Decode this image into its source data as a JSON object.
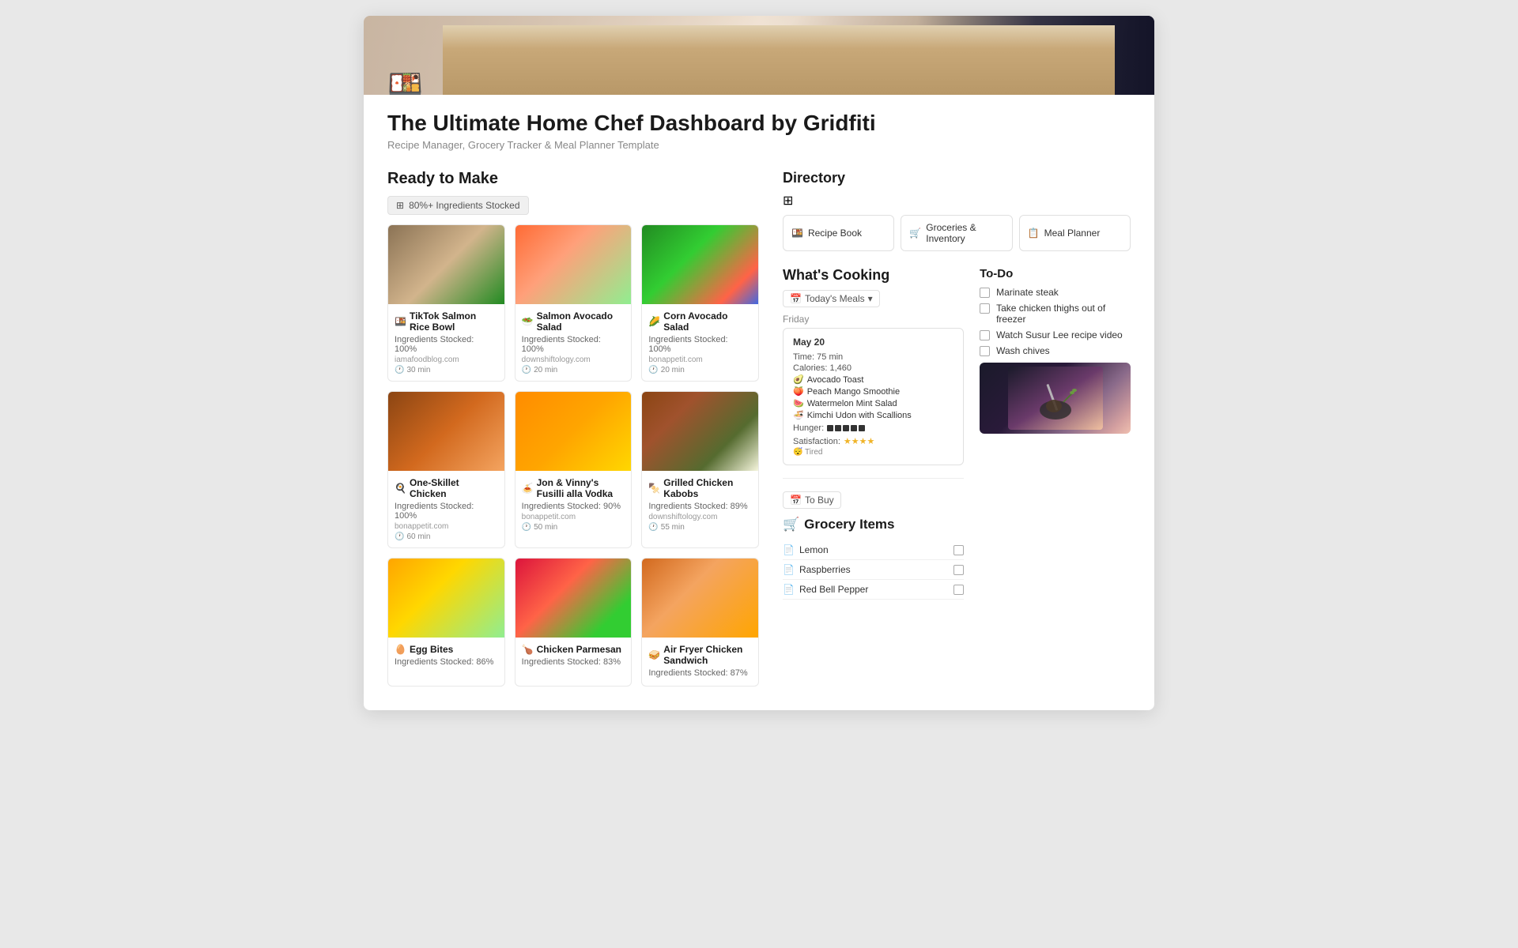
{
  "page": {
    "title": "The Ultimate Home Chef Dashboard by Gridfiti",
    "subtitle": "Recipe Manager, Grocery Tracker & Meal Planner Template",
    "emoji": "🍱"
  },
  "left": {
    "section_title": "Ready to Make",
    "filter_label": "80%+ Ingredients Stocked",
    "recipes": [
      {
        "name": "TikTok Salmon Rice Bowl",
        "emoji": "🍱",
        "stocked": "Ingredients Stocked: 100%",
        "source": "iamafoodblog.com",
        "time": "30 min",
        "color_class": "img-salmon-rice"
      },
      {
        "name": "Salmon Avocado Salad",
        "emoji": "🥗",
        "stocked": "Ingredients Stocked: 100%",
        "source": "downshiftology.com",
        "time": "20 min",
        "color_class": "img-salmon-avocado"
      },
      {
        "name": "Corn Avocado Salad",
        "emoji": "🌽",
        "stocked": "Ingredients Stocked: 100%",
        "source": "bonappetit.com",
        "time": "20 min",
        "color_class": "img-corn-avocado"
      },
      {
        "name": "One-Skillet Chicken",
        "emoji": "🍳",
        "stocked": "Ingredients Stocked: 100%",
        "source": "bonappetit.com",
        "time": "60 min",
        "color_class": "img-chicken-skillet"
      },
      {
        "name": "Jon & Vinny's Fusilli alla Vodka",
        "emoji": "🍝",
        "stocked": "Ingredients Stocked: 90%",
        "source": "bonappetit.com",
        "time": "50 min",
        "color_class": "img-fusilli"
      },
      {
        "name": "Grilled Chicken Kabobs",
        "emoji": "🍢",
        "stocked": "Ingredients Stocked: 89%",
        "source": "downshiftology.com",
        "time": "55 min",
        "color_class": "img-kabobs"
      },
      {
        "name": "Egg Bites",
        "emoji": "🥚",
        "stocked": "Ingredients Stocked: 86%",
        "source": "",
        "time": "",
        "color_class": "img-egg-bites"
      },
      {
        "name": "Chicken Parmesan",
        "emoji": "🍗",
        "stocked": "Ingredients Stocked: 83%",
        "source": "",
        "time": "",
        "color_class": "img-chicken-parm"
      },
      {
        "name": "Air Fryer Chicken Sandwich",
        "emoji": "🥪",
        "stocked": "Ingredients Stocked: 87%",
        "source": "",
        "time": "",
        "color_class": "img-air-fryer"
      }
    ]
  },
  "right": {
    "directory": {
      "title": "Directory",
      "buttons": [
        {
          "label": "Recipe Book",
          "emoji": "🍱"
        },
        {
          "label": "Groceries & Inventory",
          "emoji": "🛒"
        },
        {
          "label": "Meal Planner",
          "emoji": "📋"
        }
      ]
    },
    "whats_cooking": {
      "title": "What's Cooking",
      "today_meals_label": "Today's Meals",
      "day": "Friday",
      "meal_card": {
        "date": "May 20",
        "time": "Time: 75 min",
        "calories": "Calories: 1,460",
        "items": [
          {
            "emoji": "🥑",
            "name": "Avocado Toast"
          },
          {
            "emoji": "🍑",
            "name": "Peach Mango Smoothie"
          },
          {
            "emoji": "🍉",
            "name": "Watermelon Mint Salad"
          },
          {
            "emoji": "🍜",
            "name": "Kimchi Udon with Scallions"
          }
        ],
        "hunger_label": "Hunger:",
        "hunger_bars": 5,
        "satisfaction_label": "Satisfaction:",
        "satisfaction_stars": "★★★★",
        "mood": "😴 Tired"
      }
    },
    "todo": {
      "title": "To-Do",
      "items": [
        "Marinate steak",
        "Take chicken thighs out of freezer",
        "Watch Susur Lee recipe video",
        "Wash chives"
      ]
    },
    "grocery": {
      "to_buy_label": "To Buy",
      "title": "Grocery Items",
      "cart_emoji": "🛒",
      "items": [
        "Lemon",
        "Raspberries",
        "Red Bell Pepper"
      ]
    }
  }
}
